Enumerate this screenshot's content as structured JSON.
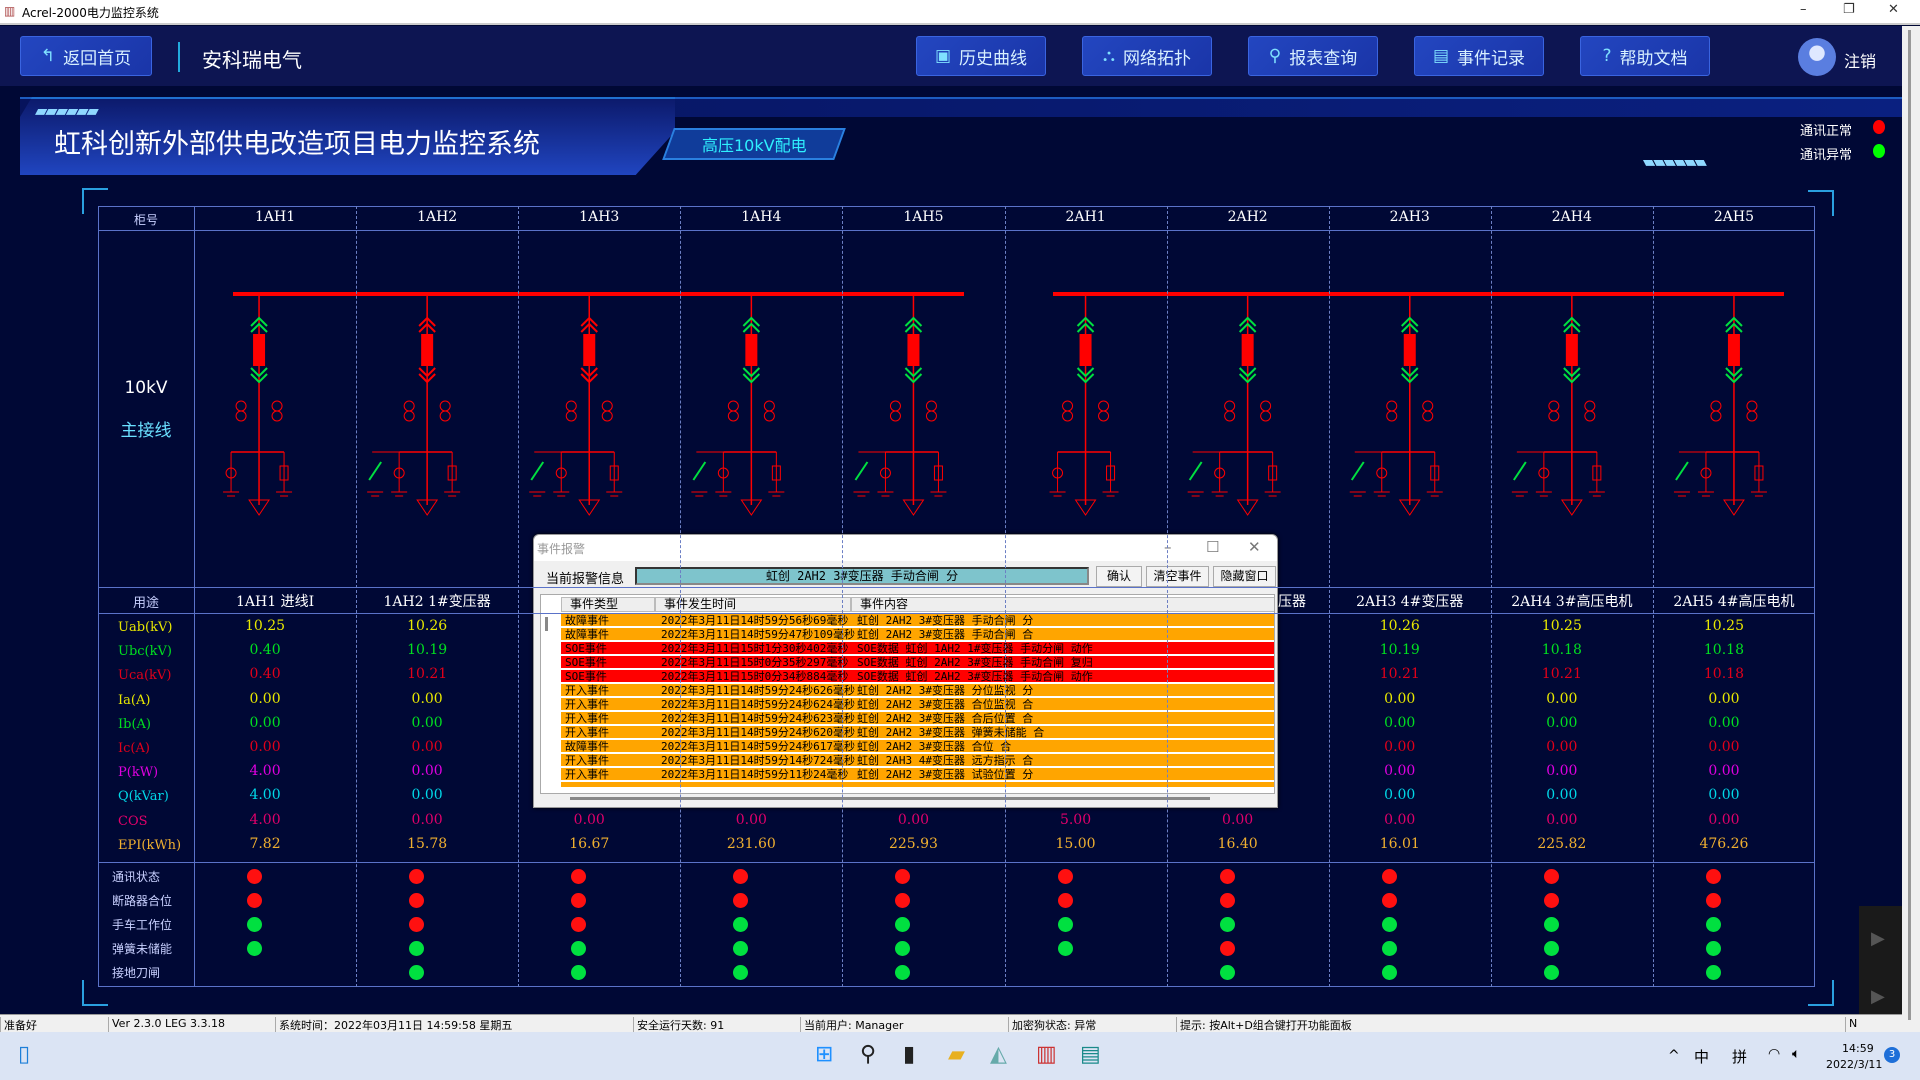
{
  "window": {
    "title": "Acrel-2000电力监控系统",
    "min": "–",
    "restore": "❐",
    "close": "✕"
  },
  "header": {
    "back": "返回首页",
    "company": "安科瑞电气",
    "nav": [
      {
        "label": "历史曲线",
        "icon": "chart-icon",
        "glyph": "▣"
      },
      {
        "label": "网络拓扑",
        "icon": "topology-icon",
        "glyph": "⛬"
      },
      {
        "label": "报表查询",
        "icon": "search-icon",
        "glyph": "⚲"
      },
      {
        "label": "事件记录",
        "icon": "document-icon",
        "glyph": "▤"
      },
      {
        "label": "帮助文档",
        "icon": "help-icon",
        "glyph": "?"
      }
    ],
    "logout": "注销"
  },
  "banner": {
    "title": "虹科创新外部供电改造项目电力监控系统",
    "tab": "高压10kV配电"
  },
  "legend": [
    {
      "label": "通讯正常",
      "color": "#ff0000"
    },
    {
      "label": "通讯异常",
      "color": "#00ff00"
    }
  ],
  "table": {
    "header_label": "柜号",
    "cabinets": [
      "1AH1",
      "1AH2",
      "1AH3",
      "1AH4",
      "1AH5",
      "2AH1",
      "2AH2",
      "2AH3",
      "2AH4",
      "2AH5"
    ],
    "bus_label": "10kV",
    "bus_sub": "主接线",
    "usage_label": "用途",
    "usages": [
      "1AH1 进线I",
      "1AH2 1#变压器",
      null,
      null,
      null,
      null,
      "压器",
      "2AH3 4#变压器",
      "2AH4 3#高压电机",
      "2AH5 4#高压电机"
    ],
    "busbar_color": "#ff0000",
    "measurements": [
      {
        "label": "Uab(kV)",
        "color": "#e8e800",
        "values": [
          "10.25",
          "10.26",
          null,
          null,
          null,
          null,
          null,
          "10.26",
          "10.25",
          "10.25"
        ]
      },
      {
        "label": "Ubc(kV)",
        "color": "#00e020",
        "values": [
          "0.40",
          "10.19",
          null,
          null,
          null,
          null,
          null,
          "10.19",
          "10.18",
          "10.18"
        ]
      },
      {
        "label": "Uca(kV)",
        "color": "#e0001a",
        "values": [
          "0.40",
          "10.21",
          null,
          null,
          null,
          null,
          null,
          "10.21",
          "10.21",
          "10.18"
        ]
      },
      {
        "label": "Ia(A)",
        "color": "#e8e800",
        "values": [
          "0.00",
          "0.00",
          null,
          null,
          null,
          null,
          null,
          "0.00",
          "0.00",
          "0.00"
        ]
      },
      {
        "label": "Ib(A)",
        "color": "#00e020",
        "values": [
          "0.00",
          "0.00",
          null,
          null,
          null,
          null,
          null,
          "0.00",
          "0.00",
          "0.00"
        ]
      },
      {
        "label": "Ic(A)",
        "color": "#e0001a",
        "values": [
          "0.00",
          "0.00",
          null,
          null,
          null,
          null,
          null,
          "0.00",
          "0.00",
          "0.00"
        ]
      },
      {
        "label": "P(kW)",
        "color": "#e000e0",
        "values": [
          "4.00",
          "0.00",
          null,
          null,
          null,
          null,
          null,
          "0.00",
          "0.00",
          "0.00"
        ]
      },
      {
        "label": "Q(kVar)",
        "color": "#00d8e8",
        "values": [
          "4.00",
          "0.00",
          null,
          null,
          null,
          null,
          null,
          "0.00",
          "0.00",
          "0.00"
        ]
      },
      {
        "label": "COS",
        "color": "#e0006a",
        "values": [
          "4.00",
          "0.00",
          "0.00",
          "0.00",
          "0.00",
          "5.00",
          "0.00",
          "0.00",
          "0.00",
          "0.00"
        ]
      },
      {
        "label": "EPI(kWh)",
        "color": "#f0b030",
        "values": [
          "7.82",
          "15.78",
          "16.67",
          "231.60",
          "225.93",
          "15.00",
          "16.40",
          "16.01",
          "225.82",
          "476.26"
        ]
      }
    ],
    "status": [
      {
        "label": "通讯状态",
        "values": [
          "red",
          "red",
          "red",
          "red",
          "red",
          "red",
          "red",
          "red",
          "red",
          "red"
        ]
      },
      {
        "label": "断路器合位",
        "values": [
          "red",
          "red",
          "red",
          "red",
          "red",
          "red",
          "red",
          "red",
          "red",
          "red"
        ]
      },
      {
        "label": "手车工作位",
        "values": [
          "green",
          "red",
          "red",
          "green",
          "green",
          "green",
          "green",
          "green",
          "green",
          "green"
        ]
      },
      {
        "label": "弹簧未储能",
        "values": [
          "green",
          "green",
          "green",
          "green",
          "green",
          "green",
          "red",
          "green",
          "green",
          "green"
        ]
      },
      {
        "label": "接地刀闸",
        "values": [
          null,
          "green",
          "green",
          "green",
          "green",
          null,
          "green",
          "green",
          "green",
          "green"
        ]
      }
    ]
  },
  "dialog": {
    "title": "事件报警",
    "alert_label": "当前报警信息",
    "alert_value": "虹创 2AH2 3#变压器 手动合闸 分",
    "confirm": "确认",
    "clear": "清空事件",
    "hide": "隐藏窗口",
    "columns": [
      "事件类型",
      "事件发生时间",
      "事件内容"
    ],
    "colors": {
      "fault": "#ffa500",
      "soe": "#ff0000",
      "input": "#ffa500"
    },
    "rows": [
      {
        "kind": "fault",
        "type": "故障事件",
        "time": "2022年3月11日14时59分56秒69毫秒",
        "content": "虹创 2AH2 3#变压器 手动合闸 分"
      },
      {
        "kind": "fault",
        "type": "故障事件",
        "time": "2022年3月11日14时59分47秒109毫秒",
        "content": "虹创 2AH2 3#变压器 手动合闸 合"
      },
      {
        "kind": "soe",
        "type": "SOE事件",
        "time": "2022年3月11日15时1分30秒402毫秒",
        "content": "SOE数据 虹创 1AH2 1#变压器 手动分闸 动作"
      },
      {
        "kind": "soe",
        "type": "SOE事件",
        "time": "2022年3月11日15时0分35秒297毫秒",
        "content": "SOE数据 虹创 2AH2 3#变压器 手动合闸 复归"
      },
      {
        "kind": "soe",
        "type": "SOE事件",
        "time": "2022年3月11日15时0分34秒884毫秒",
        "content": "SOE数据 虹创 2AH2 3#变压器 手动合闸 动作"
      },
      {
        "kind": "input",
        "type": "开入事件",
        "time": "2022年3月11日14时59分24秒626毫秒",
        "content": "虹创 2AH2 3#变压器 分位监视 分"
      },
      {
        "kind": "input",
        "type": "开入事件",
        "time": "2022年3月11日14时59分24秒624毫秒",
        "content": "虹创 2AH2 3#变压器 合位监视 合"
      },
      {
        "kind": "input",
        "type": "开入事件",
        "time": "2022年3月11日14时59分24秒623毫秒",
        "content": "虹创 2AH2 3#变压器 合后位置 合"
      },
      {
        "kind": "input",
        "type": "开入事件",
        "time": "2022年3月11日14时59分24秒620毫秒",
        "content": "虹创 2AH2 3#变压器 弹簧未储能 合"
      },
      {
        "kind": "fault",
        "type": "故障事件",
        "time": "2022年3月11日14时59分24秒617毫秒",
        "content": "虹创 2AH2 3#变压器 合位 合"
      },
      {
        "kind": "input",
        "type": "开入事件",
        "time": "2022年3月11日14时59分14秒724毫秒",
        "content": "虹创 2AH3 4#变压器 远方指示 合"
      },
      {
        "kind": "input",
        "type": "开入事件",
        "time": "2022年3月11日14时59分11秒24毫秒",
        "content": "虹创 2AH2 3#变压器 试验位置 分"
      }
    ]
  },
  "statusbar": [
    "准备好",
    "Ver 2.3.0 LEG 3.3.18",
    "系统时间：2022年03月11日  14:59:58  星期五",
    "安全运行天数:  91",
    "当前用户:  Manager",
    "加密狗状态:  异常",
    "提示:  按Alt+D组合键打开功能面板",
    "N"
  ],
  "taskbar": {
    "time": "14:59",
    "date": "2022/3/11",
    "ime": "中",
    "ime_mode": "拼",
    "badge": "3",
    "chevron": "^"
  }
}
